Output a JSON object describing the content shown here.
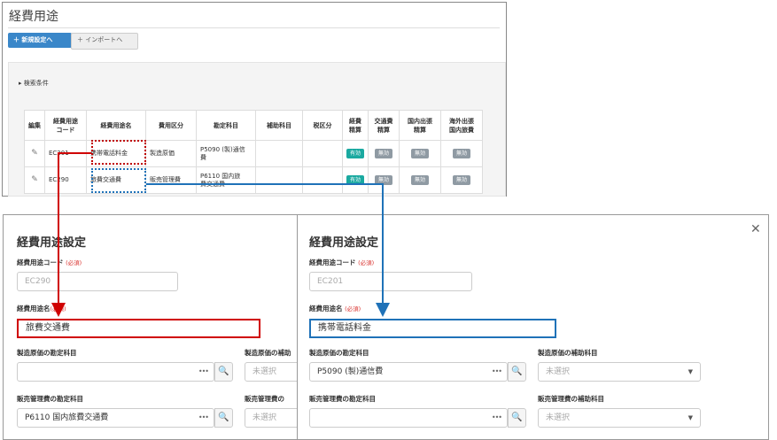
{
  "top": {
    "title": "経費用途",
    "new_button": "＋ 新規設定へ",
    "import_button": "＋ インポートへ",
    "search_toggle": "▸  検索条件",
    "columns": [
      "編集",
      "経費用途\nコード",
      "経費用途名",
      "費用区分",
      "勘定科目",
      "補助科目",
      "税区分",
      "経費\n精算",
      "交通費\n精算",
      "国内出張\n精算",
      "海外出張\n国内旅費"
    ],
    "rows": [
      {
        "code": "EC201",
        "name": "携帯電話料金",
        "category": "製造原価",
        "account": "P5090 (製)通信\n費",
        "sub": "",
        "tax": "",
        "flags": [
          "有効",
          "無効",
          "無効",
          "無効"
        ]
      },
      {
        "code": "EC290",
        "name": "旅費交通費",
        "category": "販売管理費",
        "account": "P6110 国内旅\n費交通費",
        "sub": "",
        "tax": "",
        "flags": [
          "有効",
          "無効",
          "無効",
          "無効"
        ]
      }
    ]
  },
  "left_dialog": {
    "title": "経費用途設定",
    "code_label": "経費用途コード",
    "code_required": "(必須)",
    "code_value": "EC290",
    "name_label": "経費用途名",
    "name_required": "(必須)",
    "name_value": "旅費交通費",
    "mfg_account_label": "製造原価の勘定科目",
    "mfg_account_value": "",
    "mfg_sub_label": "製造原価の補助",
    "mfg_sub_value": "未選択",
    "sga_account_label": "販売管理費の勘定科目",
    "sga_account_value": "P6110 国内旅費交通費",
    "sga_sub_label": "販売管理費の",
    "sga_sub_value": "未選択",
    "dots": "•••"
  },
  "right_dialog": {
    "title": "経費用途設定",
    "close": "✕",
    "code_label": "経費用途コード",
    "code_required": "(必須)",
    "code_value": "EC201",
    "name_label": "経費用途名",
    "name_required": "(必須)",
    "name_value": "携帯電話料金",
    "mfg_account_label": "製造原価の勘定科目",
    "mfg_account_value": "P5090 (製)通信費",
    "mfg_sub_label": "製造原価の補助科目",
    "mfg_sub_value": "未選択",
    "sga_account_label": "販売管理費の勘定科目",
    "sga_account_value": "",
    "sga_sub_label": "販売管理費の補助科目",
    "sga_sub_value": "未選択",
    "dots": "•••"
  },
  "icons": {
    "search": "search-icon",
    "edit": "edit-icon",
    "caret": "chevron-down-icon",
    "close": "close-icon"
  },
  "colors": {
    "primary_button": "#3a87c9",
    "active_pill": "#1aa9a0",
    "inactive_pill": "#8f9aa3",
    "highlight_red": "#d00000",
    "highlight_blue": "#1f72b8"
  }
}
